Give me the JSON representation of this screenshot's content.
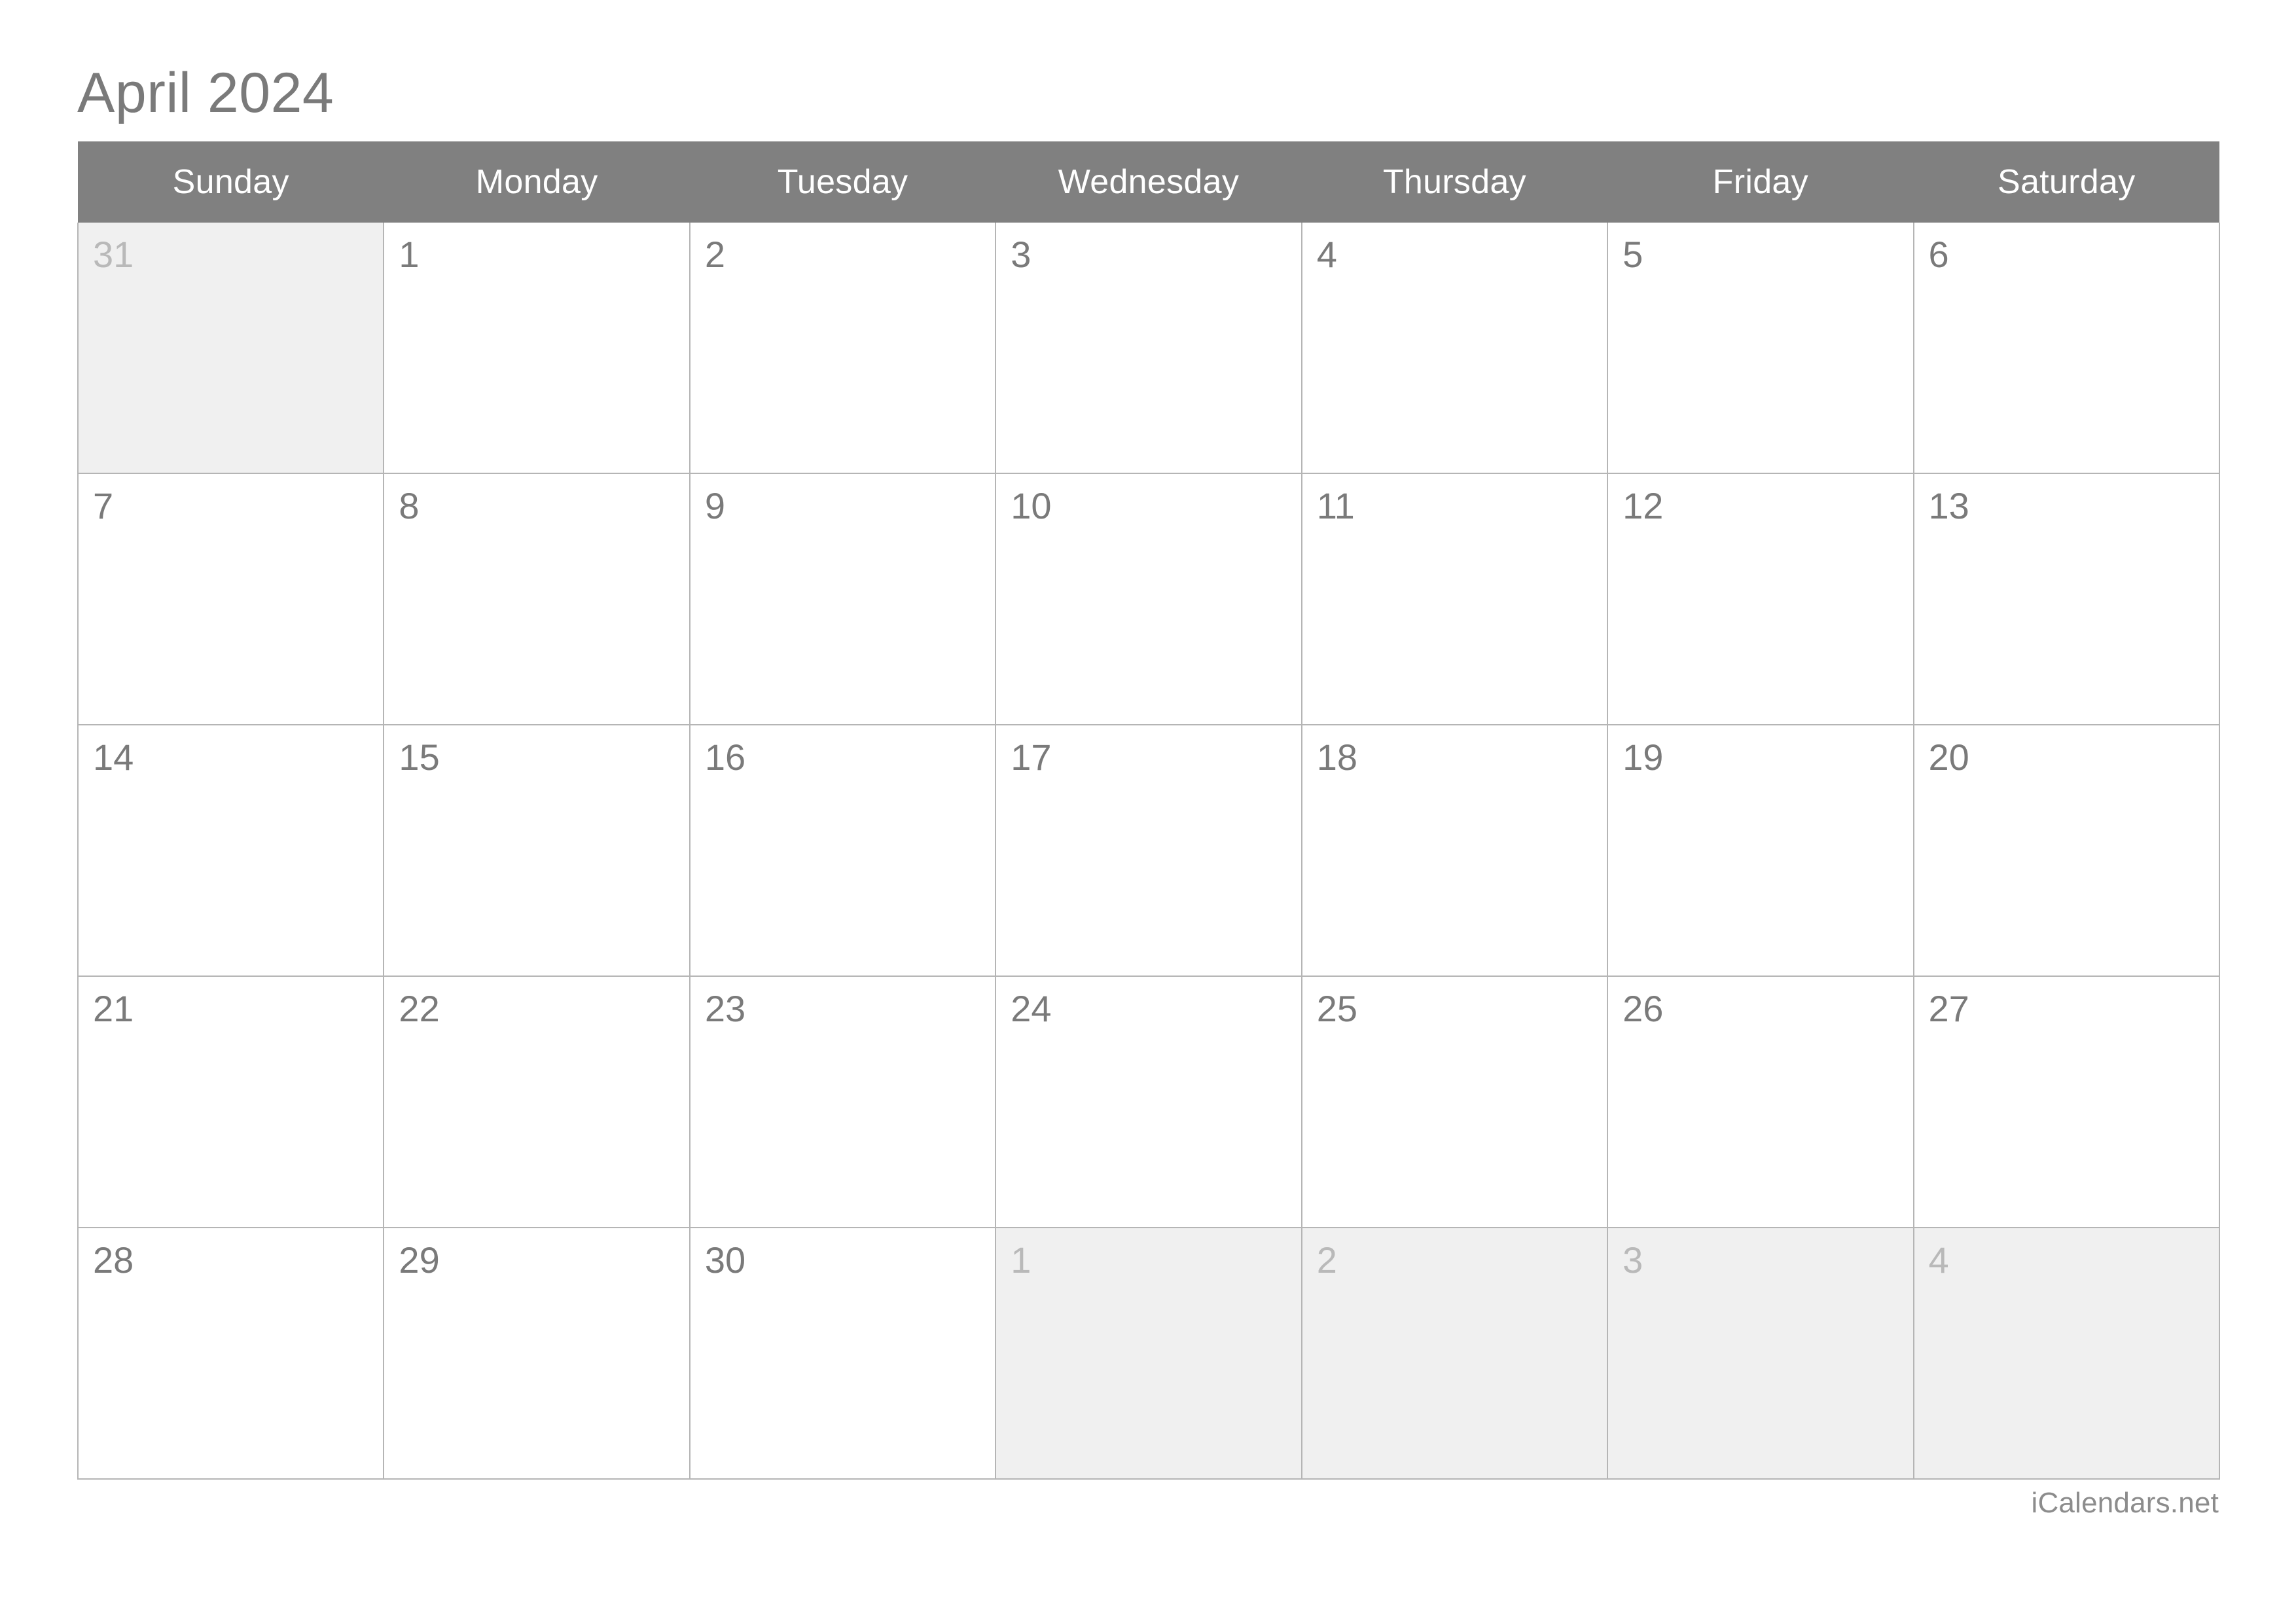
{
  "title": "April 2024",
  "month": "April",
  "year": "2024",
  "weekday_headers": [
    "Sunday",
    "Monday",
    "Tuesday",
    "Wednesday",
    "Thursday",
    "Friday",
    "Saturday"
  ],
  "footer": "iCalendars.net",
  "colors": {
    "header_background": "#808080",
    "header_text": "#ffffff",
    "title_text": "#7a7a7a",
    "day_number": "#7a7a7a",
    "adjacent_day_number": "#b9b9b9",
    "adjacent_cell_background": "#f0f0f0",
    "cell_background": "#ffffff",
    "grid_border": "#b5b5b5",
    "footer_text": "#8c8c8c"
  },
  "weeks": [
    [
      {
        "day": "31",
        "adjacent": true
      },
      {
        "day": "1",
        "adjacent": false
      },
      {
        "day": "2",
        "adjacent": false
      },
      {
        "day": "3",
        "adjacent": false
      },
      {
        "day": "4",
        "adjacent": false
      },
      {
        "day": "5",
        "adjacent": false
      },
      {
        "day": "6",
        "adjacent": false
      }
    ],
    [
      {
        "day": "7",
        "adjacent": false
      },
      {
        "day": "8",
        "adjacent": false
      },
      {
        "day": "9",
        "adjacent": false
      },
      {
        "day": "10",
        "adjacent": false
      },
      {
        "day": "11",
        "adjacent": false
      },
      {
        "day": "12",
        "adjacent": false
      },
      {
        "day": "13",
        "adjacent": false
      }
    ],
    [
      {
        "day": "14",
        "adjacent": false
      },
      {
        "day": "15",
        "adjacent": false
      },
      {
        "day": "16",
        "adjacent": false
      },
      {
        "day": "17",
        "adjacent": false
      },
      {
        "day": "18",
        "adjacent": false
      },
      {
        "day": "19",
        "adjacent": false
      },
      {
        "day": "20",
        "adjacent": false
      }
    ],
    [
      {
        "day": "21",
        "adjacent": false
      },
      {
        "day": "22",
        "adjacent": false
      },
      {
        "day": "23",
        "adjacent": false
      },
      {
        "day": "24",
        "adjacent": false
      },
      {
        "day": "25",
        "adjacent": false
      },
      {
        "day": "26",
        "adjacent": false
      },
      {
        "day": "27",
        "adjacent": false
      }
    ],
    [
      {
        "day": "28",
        "adjacent": false
      },
      {
        "day": "29",
        "adjacent": false
      },
      {
        "day": "30",
        "adjacent": false
      },
      {
        "day": "1",
        "adjacent": true
      },
      {
        "day": "2",
        "adjacent": true
      },
      {
        "day": "3",
        "adjacent": true
      },
      {
        "day": "4",
        "adjacent": true
      }
    ]
  ]
}
